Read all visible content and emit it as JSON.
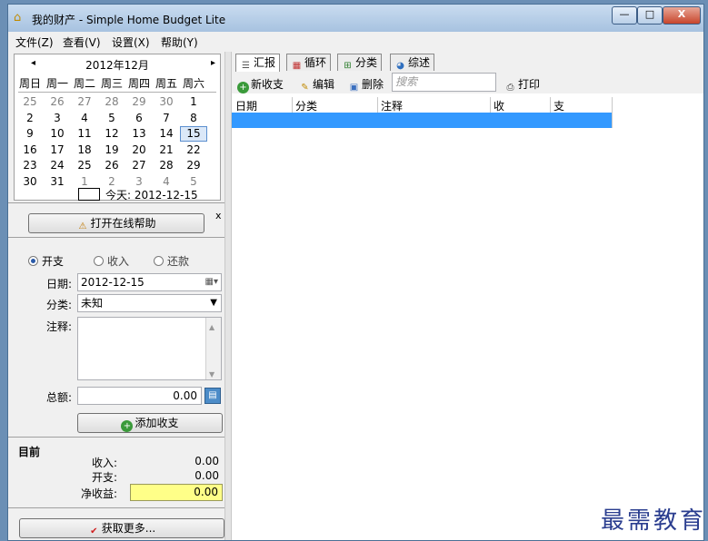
{
  "window": {
    "title": "我的财产 - Simple Home Budget Lite",
    "minimize_label": "—",
    "maximize_label": "□",
    "close_label": "X"
  },
  "menu": [
    "文件(Z)",
    "查看(V)",
    "设置(X)",
    "帮助(Y)"
  ],
  "calendar": {
    "prev_label": "◂",
    "next_label": "▸",
    "month_title": "2012年12月",
    "weekdays": [
      "周日",
      "周一",
      "周二",
      "周三",
      "周四",
      "周五",
      "周六"
    ],
    "weeks": [
      [
        "25",
        "26",
        "27",
        "28",
        "29",
        "30",
        "1"
      ],
      [
        "2",
        "3",
        "4",
        "5",
        "6",
        "7",
        "8"
      ],
      [
        "9",
        "10",
        "11",
        "12",
        "13",
        "14",
        "15"
      ],
      [
        "16",
        "17",
        "18",
        "19",
        "20",
        "21",
        "22"
      ],
      [
        "23",
        "24",
        "25",
        "26",
        "27",
        "28",
        "29"
      ],
      [
        "30",
        "31",
        "1",
        "2",
        "3",
        "4",
        "5"
      ]
    ],
    "selected": "15",
    "today_label": "今天: 2012-12-15"
  },
  "help_panel": {
    "online_help_button": "打开在线帮助",
    "close_label": "x"
  },
  "entry_form": {
    "type_options": [
      "开支",
      "收入",
      "还款"
    ],
    "selected_type": "开支",
    "date_label": "日期:",
    "date_value": "2012-12-15",
    "category_label": "分类:",
    "category_value": "未知",
    "note_label": "注释:",
    "note_value": "",
    "total_label": "总额:",
    "total_value": "0.00",
    "add_button": "添加收支"
  },
  "summary": {
    "heading": "目前",
    "income_label": "收入:",
    "income_value": "0.00",
    "expense_label": "开支:",
    "expense_value": "0.00",
    "net_label": "净收益:",
    "net_value": "0.00"
  },
  "more_button": "获取更多...",
  "tabs": [
    "汇报",
    "循环",
    "分类",
    "综述"
  ],
  "active_tab": "汇报",
  "toolbar": {
    "new_label": "新收支",
    "edit_label": "编辑",
    "delete_label": "删除",
    "search_placeholder": "搜索",
    "print_label": "打印"
  },
  "table": {
    "columns": [
      "日期",
      "分类",
      "注释",
      "收",
      "支"
    ],
    "rows": [
      [
        "",
        "",
        "",
        "",
        ""
      ]
    ]
  },
  "watermark": "最需教育",
  "colors": {
    "selection": "#3399ff",
    "net_highlight": "#ffff88",
    "title_gradient_top": "#c9dcf0"
  }
}
